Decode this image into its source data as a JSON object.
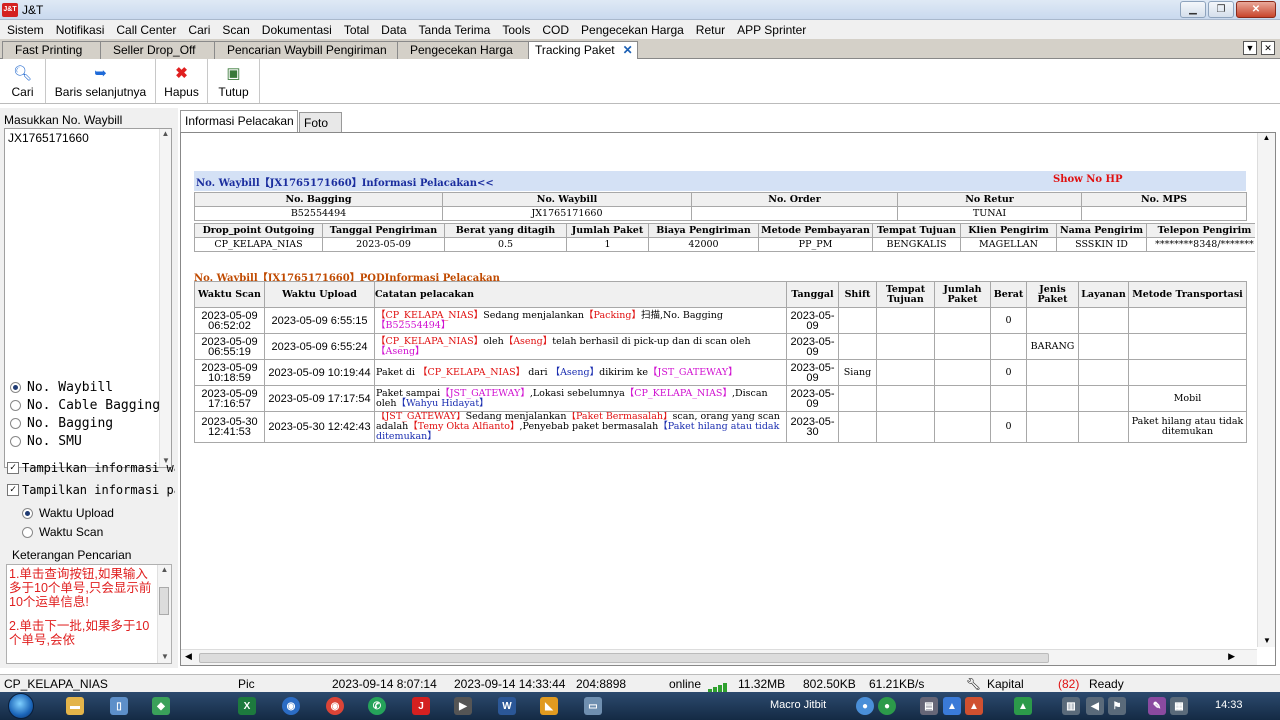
{
  "window": {
    "title": "J&T",
    "logo": "J&T"
  },
  "menu": [
    "Sistem",
    "Notifikasi",
    "Call Center",
    "Cari",
    "Scan",
    "Dokumentasi",
    "Total",
    "Data",
    "Tanda Terima",
    "Tools",
    "COD",
    "Pengecekan Harga",
    "Retur",
    "APP Sprinter"
  ],
  "doc_tabs": [
    "Fast Printing",
    "Seller Drop_Off",
    "Pencarian Waybill Pengiriman",
    "Pengecekan Harga",
    "Tracking Paket"
  ],
  "doc_tab_close": "✕",
  "toolbar": {
    "cari": "Cari",
    "baris": "Baris selanjutnya",
    "hapus": "Hapus",
    "tutup": "Tutup"
  },
  "left": {
    "input_label": "Masukkan No. Waybill",
    "waybill_value": "JX1765171660",
    "radios": [
      "No. Waybill",
      "No. Cable Bagging",
      "No. Bagging",
      "No. SMU"
    ],
    "check1": "Tampilkan informasi way",
    "check2": "Tampilkan informasi pak",
    "sub_radio1": "Waktu Upload",
    "sub_radio2": "Waktu Scan",
    "notes_title": "Keterangan Pencarian",
    "note1": "1.单击查询按钮,如果输入多于10个单号,只会显示前10个运单信息!",
    "note2": "2.单击下一批,如果多于10个单号,会依"
  },
  "right_tabs": [
    "Informasi Pelacakan",
    "Foto"
  ],
  "tracking": {
    "section1": "No. Waybill【JX1765171660】Informasi Pelacakan<<",
    "show_hp": "Show No HP",
    "t1_headers": [
      "No. Bagging",
      "No. Waybill",
      "No. Order",
      "No Retur",
      "No. MPS"
    ],
    "t1_values": [
      "B52554494",
      "JX1765171660",
      "",
      "TUNAI",
      ""
    ],
    "t2_headers": [
      "Drop_point Outgoing",
      "Tanggal Pengiriman",
      "Berat yang ditagih",
      "Jumlah Paket",
      "Biaya Pengiriman",
      "Metode Pembayaran",
      "Tempat Tujuan",
      "Klien Pengirim",
      "Nama Pengirim",
      "Telepon Pengirim"
    ],
    "t2_values": [
      "CP_KELAPA_NIAS",
      "2023-05-09",
      "0.5",
      "1",
      "42000",
      "PP_PM",
      "BENGKALIS",
      "MAGELLAN",
      "SSSKIN ID",
      "********8348/*******"
    ],
    "section2": "No. Waybill【JX1765171660】PODInformasi Pelacakan",
    "t3_headers": [
      "Waktu Scan",
      "Waktu Upload",
      "Catatan pelacakan",
      "Tanggal",
      "Shift",
      "Tempat Tujuan",
      "Jumlah Paket",
      "Berat",
      "Jenis Paket",
      "Layanan",
      "Metode Transportasi"
    ],
    "rows": [
      {
        "scan": "2023-05-09 06:52:02",
        "upload": "2023-05-09 6:55:15",
        "tanggal": "2023-05-09",
        "shift": "",
        "tujuan": "",
        "jumlah": "",
        "berat": "0",
        "jenis": "",
        "layanan": "",
        "transport": "",
        "note": [
          [
            "red",
            "【CP_KELAPA_NIAS】"
          ],
          [
            "",
            "Sedang menjalankan"
          ],
          [
            "red",
            "【Packing】"
          ],
          [
            "",
            "扫描,No. Bagging"
          ],
          [
            "mag",
            "【B52554494】"
          ]
        ]
      },
      {
        "scan": "2023-05-09 06:55:19",
        "upload": "2023-05-09 6:55:24",
        "tanggal": "2023-05-09",
        "shift": "",
        "tujuan": "",
        "jumlah": "",
        "berat": "",
        "jenis": "BARANG",
        "layanan": "",
        "transport": "",
        "note": [
          [
            "red",
            "【CP_KELAPA_NIAS】"
          ],
          [
            "",
            "oleh"
          ],
          [
            "red",
            "【Aseng】"
          ],
          [
            "",
            "telah berhasil di pick-up dan di scan oleh"
          ],
          [
            "mag",
            "【Aseng】"
          ]
        ]
      },
      {
        "scan": "2023-05-09 10:18:59",
        "upload": "2023-05-09 10:19:44",
        "tanggal": "2023-05-09",
        "shift": "Siang",
        "tujuan": "",
        "jumlah": "",
        "berat": "0",
        "jenis": "",
        "layanan": "",
        "transport": "",
        "note": [
          [
            "",
            "Paket di "
          ],
          [
            "red",
            "【CP_KELAPA_NIAS】"
          ],
          [
            "",
            "  dari  "
          ],
          [
            "blu",
            "【Aseng】"
          ],
          [
            "",
            "dikirim ke"
          ],
          [
            "mag",
            "【JST_GATEWAY】"
          ]
        ]
      },
      {
        "scan": "2023-05-09 17:16:57",
        "upload": "2023-05-09 17:17:54",
        "tanggal": "2023-05-09",
        "shift": "",
        "tujuan": "",
        "jumlah": "",
        "berat": "",
        "jenis": "",
        "layanan": "",
        "transport": "Mobil",
        "note": [
          [
            "",
            "Paket sampai"
          ],
          [
            "mag",
            "【JST_GATEWAY】"
          ],
          [
            "",
            ",Lokasi sebelumnya"
          ],
          [
            "mag",
            "【CP_KELAPA_NIAS】"
          ],
          [
            "",
            ",Discan oleh"
          ],
          [
            "blu",
            "【Wahyu Hidayat】"
          ]
        ]
      },
      {
        "scan": "2023-05-30 12:41:53",
        "upload": "2023-05-30 12:42:43",
        "tanggal": "2023-05-30",
        "shift": "",
        "tujuan": "",
        "jumlah": "",
        "berat": "0",
        "jenis": "",
        "layanan": "",
        "transport": "Paket hilang atau tidak ditemukan",
        "note": [
          [
            "red",
            "【JST_GATEWAY】"
          ],
          [
            "",
            "Sedang menjalankan"
          ],
          [
            "red",
            "【Paket Bermasalah】"
          ],
          [
            "",
            "scan, orang yang scan adalah"
          ],
          [
            "red",
            "【Temy Okta Alfianto】"
          ],
          [
            "",
            ",Penyebab paket bermasalah"
          ],
          [
            "blu",
            "【Paket hilang atau tidak ditemukan】"
          ]
        ]
      }
    ]
  },
  "status": {
    "location": "CP_KELAPA_NIAS",
    "pic": "Pic",
    "time1": "2023-09-14 8:07:14",
    "time2": "2023-09-14 14:33:44",
    "code": "204:8898",
    "online": "online",
    "mem": "11.32MB",
    "kb": "802.50KB",
    "speed": "61.21KB/s",
    "kapital": "Kapital",
    "count": "(82)",
    "ready": "Ready"
  },
  "taskbar": {
    "macro": "Macro Jitbit",
    "clock": "14:33"
  },
  "colors": {
    "accent_red": "#e01010",
    "magenta": "#d010d0",
    "blue": "#1a2db0",
    "header_bg": "#d4e1f5"
  }
}
